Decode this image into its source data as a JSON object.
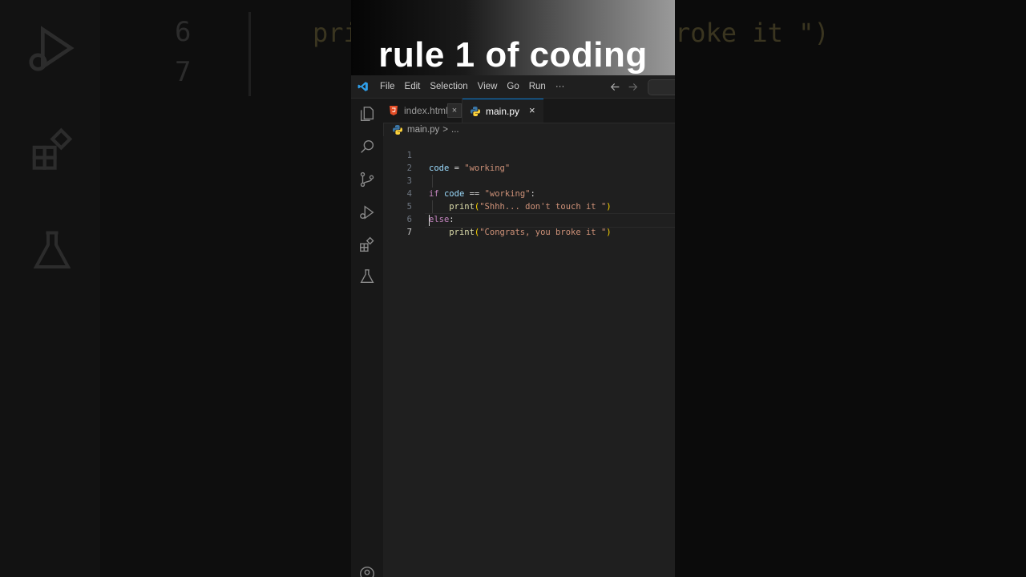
{
  "caption": "rule 1 of coding",
  "menubar": {
    "items": [
      "File",
      "Edit",
      "Selection",
      "View",
      "Go",
      "Run",
      "···"
    ],
    "back_icon": "arrow-left-icon",
    "forward_icon": "arrow-right-icon"
  },
  "activitybar": {
    "icons": [
      "explorer-icon",
      "search-icon",
      "source-control-icon",
      "run-debug-icon",
      "extensions-icon",
      "testing-icon",
      "account-icon"
    ]
  },
  "tabs": [
    {
      "label": "index.html",
      "icon": "html5-icon",
      "active": false
    },
    {
      "label": "main.py",
      "icon": "python-icon",
      "active": true
    }
  ],
  "breadcrumb": {
    "file": "main.py",
    "separator": ">",
    "more": "..."
  },
  "editor": {
    "current_line": 7,
    "lines": [
      {
        "n": "1",
        "text": "code = \"working\""
      },
      {
        "n": "2",
        "text": ""
      },
      {
        "n": "3",
        "text": "if code == \"working\":"
      },
      {
        "n": "4",
        "text": "    print(\"Shhh... don't touch it \")"
      },
      {
        "n": "5",
        "text": "else:"
      },
      {
        "n": "6",
        "text": "    print(\"Congrats, you broke it \")"
      },
      {
        "n": "7",
        "text": ""
      }
    ]
  },
  "background": {
    "line_numbers": [
      "6",
      "7"
    ],
    "code_fragment_left": "pri",
    "code_fragment_right": "roke it \")"
  },
  "colors": {
    "editor_bg": "#1f1f1f",
    "accent": "#0078d4",
    "keyword": "#c586c0",
    "string": "#ce9178",
    "variable": "#9cdcfe",
    "function": "#dcdcaa"
  }
}
